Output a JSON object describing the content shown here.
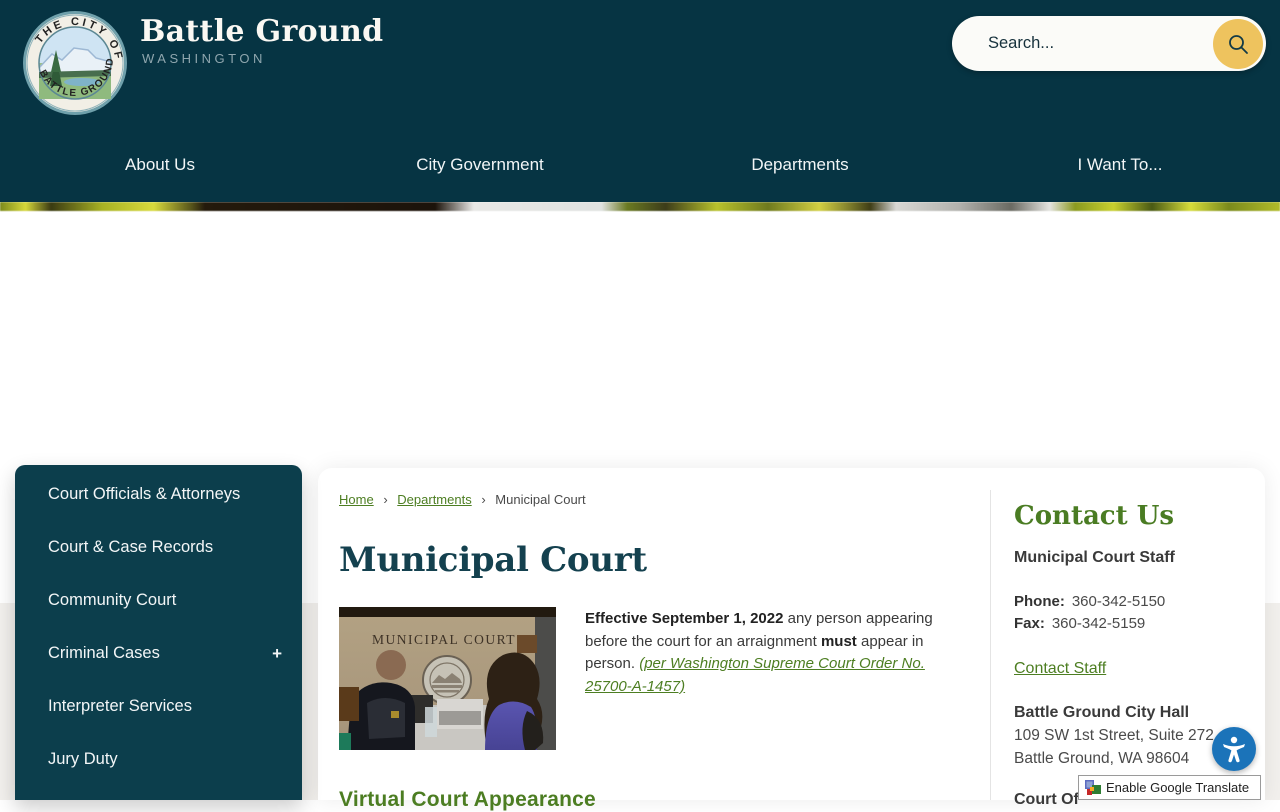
{
  "theme": {
    "header_bg": "#063443",
    "sidebar_bg": "#0c3e4c",
    "accent_green": "#4d7e22",
    "heading_teal": "#14414f",
    "search_button_yellow": "#eec35e",
    "accessibility_blue": "#1b73b9"
  },
  "header": {
    "logo_seal": {
      "top_text": "THE CITY OF",
      "bottom_text": "BATTLE GROUND"
    },
    "site_title": "Battle Ground",
    "site_subtitle": "WASHINGTON",
    "search": {
      "placeholder": "Search...",
      "icon": "search-icon"
    },
    "nav": [
      {
        "label": "About Us"
      },
      {
        "label": "City Government"
      },
      {
        "label": "Departments"
      },
      {
        "label": "I Want To..."
      }
    ]
  },
  "sidebar": {
    "items": [
      {
        "label": "Court Officials & Attorneys"
      },
      {
        "label": "Court & Case Records"
      },
      {
        "label": "Community Court"
      },
      {
        "label": "Criminal Cases",
        "expand": "+"
      },
      {
        "label": "Interpreter Services"
      },
      {
        "label": "Jury Duty"
      }
    ]
  },
  "main": {
    "breadcrumb": {
      "separator": "›",
      "items": [
        {
          "label": "Home"
        },
        {
          "label": "Departments"
        },
        {
          "label": "Municipal Court"
        }
      ]
    },
    "page_title": "Municipal Court",
    "photo": {
      "sign_text": "MUNICIPAL COURT"
    },
    "intro": {
      "bold1": "Effective September 1, 2022",
      "text1": " any person appearing before the court for an arraignment ",
      "bold2": "must",
      "text2": " appear in person. ",
      "link": "(per Washington Supreme Court Order No. 25700-A-1457)"
    },
    "section_heading": "Virtual Court Appearance"
  },
  "contact": {
    "heading": "Contact Us",
    "staff_title": "Municipal Court Staff",
    "phone_label": "Phone:",
    "phone": "360-342-5150",
    "fax_label": "Fax:",
    "fax": "360-342-5159",
    "contact_link": "Contact Staff",
    "hall_name": "Battle Ground City Hall",
    "address_line1": "109 SW 1st Street, Suite 272",
    "address_line2": "Battle Ground, WA 98604",
    "cutoff_heading": "Court Of"
  },
  "widgets": {
    "translate_label": "Enable Google Translate"
  }
}
